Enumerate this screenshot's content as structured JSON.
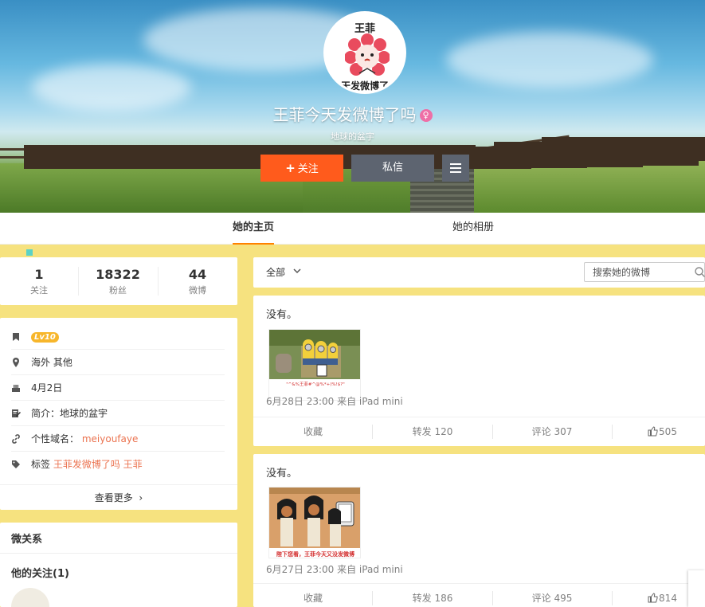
{
  "profile": {
    "avatar_text_top": "王菲",
    "avatar_text_bottom": "天发微博了",
    "name": "王菲今天发微博了吗",
    "gender_icon": "female-icon",
    "intro": "地球的盆宇",
    "follow_label": "关注",
    "message_label": "私信"
  },
  "tabs": [
    {
      "label": "她的主页",
      "active": true
    },
    {
      "label": "她的相册",
      "active": false
    }
  ],
  "stats": [
    {
      "num": "1",
      "label": "关注"
    },
    {
      "num": "18322",
      "label": "粉丝"
    },
    {
      "num": "44",
      "label": "微博"
    }
  ],
  "info": {
    "level": "Lv10",
    "location": "海外 其他",
    "birthday": "4月2日",
    "bio_label": "简介：",
    "bio": "地球的盆宇",
    "domain_label": "个性域名：",
    "domain": "meiyoufaye",
    "tags_label": "标签",
    "tags": "王菲发微博了吗 王菲",
    "more": "查看更多"
  },
  "relations": {
    "title": "微关系",
    "following": "他的关注(1)"
  },
  "filter": {
    "all": "全部",
    "search_placeholder": "搜索她的微博"
  },
  "posts": [
    {
      "text": "没有。",
      "img_caption": "\"^&%王菲#^@%*+)%!$?\"",
      "meta": "6月28日 23:00 来自 iPad mini",
      "collect": "收藏",
      "repost": "转发 120",
      "comment": "评论 307",
      "like": "505"
    },
    {
      "text": "没有。",
      "img_caption": "陛下您看，王菲今天又没发微博",
      "meta": "6月27日 23:00 来自 iPad mini",
      "collect": "收藏",
      "repost": "转发 186",
      "comment": "评论 495",
      "like": "814"
    }
  ],
  "colors": {
    "accent": "#ff5b1c",
    "link": "#eb7350",
    "background": "#f6e27f"
  }
}
